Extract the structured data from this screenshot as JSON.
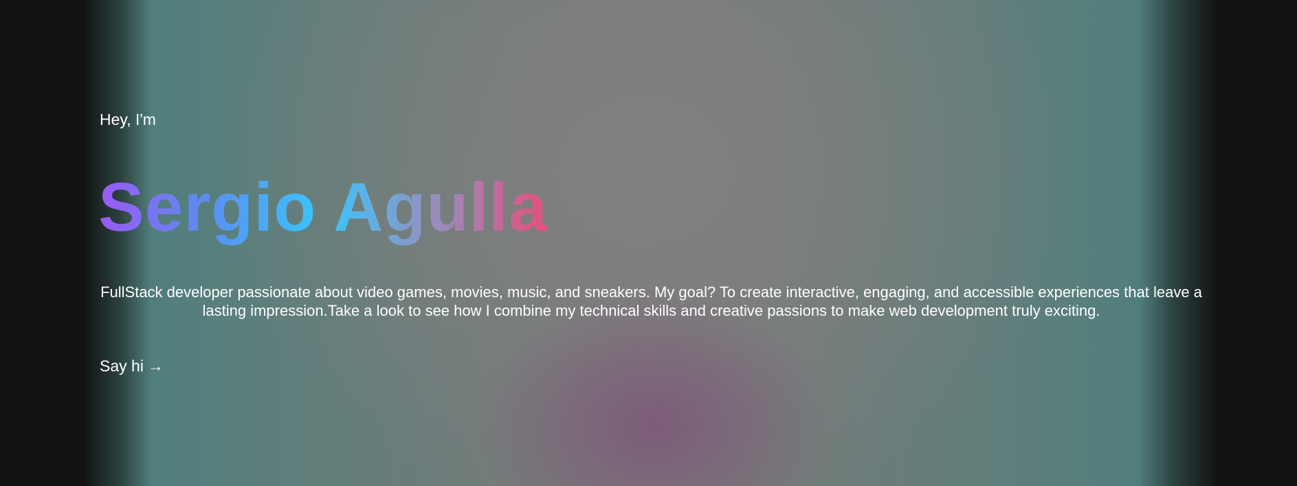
{
  "hero": {
    "greeting": "Hey, I'm",
    "name": "Sergio Agulla",
    "bio": "FullStack developer passionate about video games, movies, music, and sneakers. My goal? To create interactive, engaging, and accessible experiences that leave a lasting impression.Take a look to see how I combine my technical skills and creative passions to make web development truly exciting.",
    "cta_label": "Say hi",
    "cta_arrow": "→",
    "cta_icon": "arrow-right-icon"
  },
  "colors": {
    "background": "#121212",
    "text": "#ffffff",
    "name_gradient": [
      "#9b59f2",
      "#38c6fb",
      "#e4507f"
    ],
    "teal_glow": "#3f7c79",
    "pink_glow": "#7d5878"
  }
}
